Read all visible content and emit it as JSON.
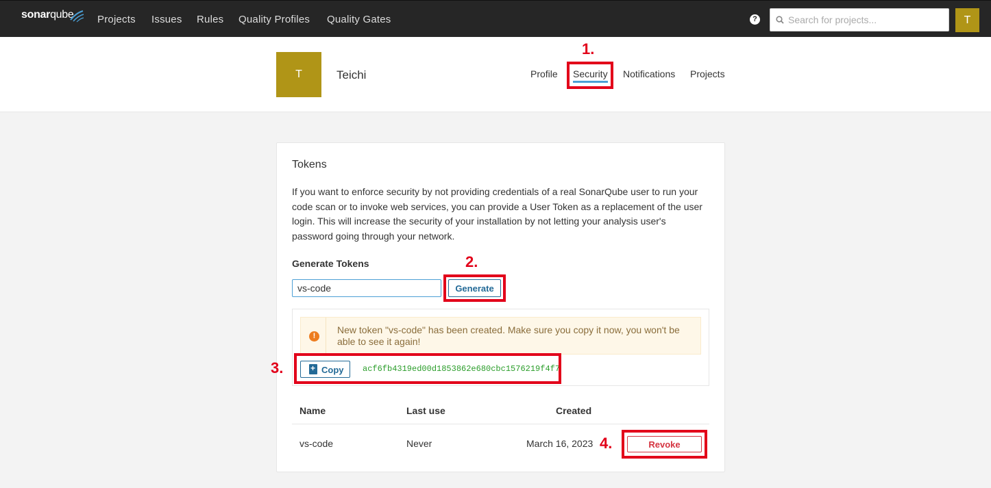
{
  "topnav": {
    "logo_bold": "sonar",
    "logo_light": "qube",
    "items": [
      "Projects",
      "Issues",
      "Rules",
      "Quality Profiles",
      "Quality Gates"
    ],
    "help_glyph": "?",
    "search_placeholder": "Search for projects...",
    "avatar_letter": "T"
  },
  "profile": {
    "avatar_letter": "T",
    "name": "Teichi",
    "tabs": [
      "Profile",
      "Security",
      "Notifications",
      "Projects"
    ],
    "active_tab": "Security"
  },
  "tokens": {
    "title": "Tokens",
    "description": "If you want to enforce security by not providing credentials of a real SonarQube user to run your code scan or to invoke web services, you can provide a User Token as a replacement of the user login. This will increase the security of your installation by not letting your analysis user's password going through your network.",
    "generate_heading": "Generate Tokens",
    "input_value": "vs-code",
    "generate_label": "Generate",
    "warning_glyph": "!",
    "warning_text": "New token \"vs-code\" has been created. Make sure you copy it now, you won't be able to see it again!",
    "copy_label": "Copy",
    "token_value": "acf6fb4319ed00d1853862e680cbc1576219f4f7",
    "table": {
      "headers": [
        "Name",
        "Last use",
        "Created"
      ],
      "rows": [
        {
          "name": "vs-code",
          "last_use": "Never",
          "created": "March 16, 2023",
          "action": "Revoke"
        }
      ]
    }
  },
  "annotations": [
    "1.",
    "2.",
    "3.",
    "4."
  ],
  "colors": {
    "topbar": "#262626",
    "avatar": "#b09517",
    "accent_blue": "#236a97",
    "annotation_red": "#e2001a",
    "token_green": "#2a9d2a",
    "revoke_red": "#d4333f"
  }
}
